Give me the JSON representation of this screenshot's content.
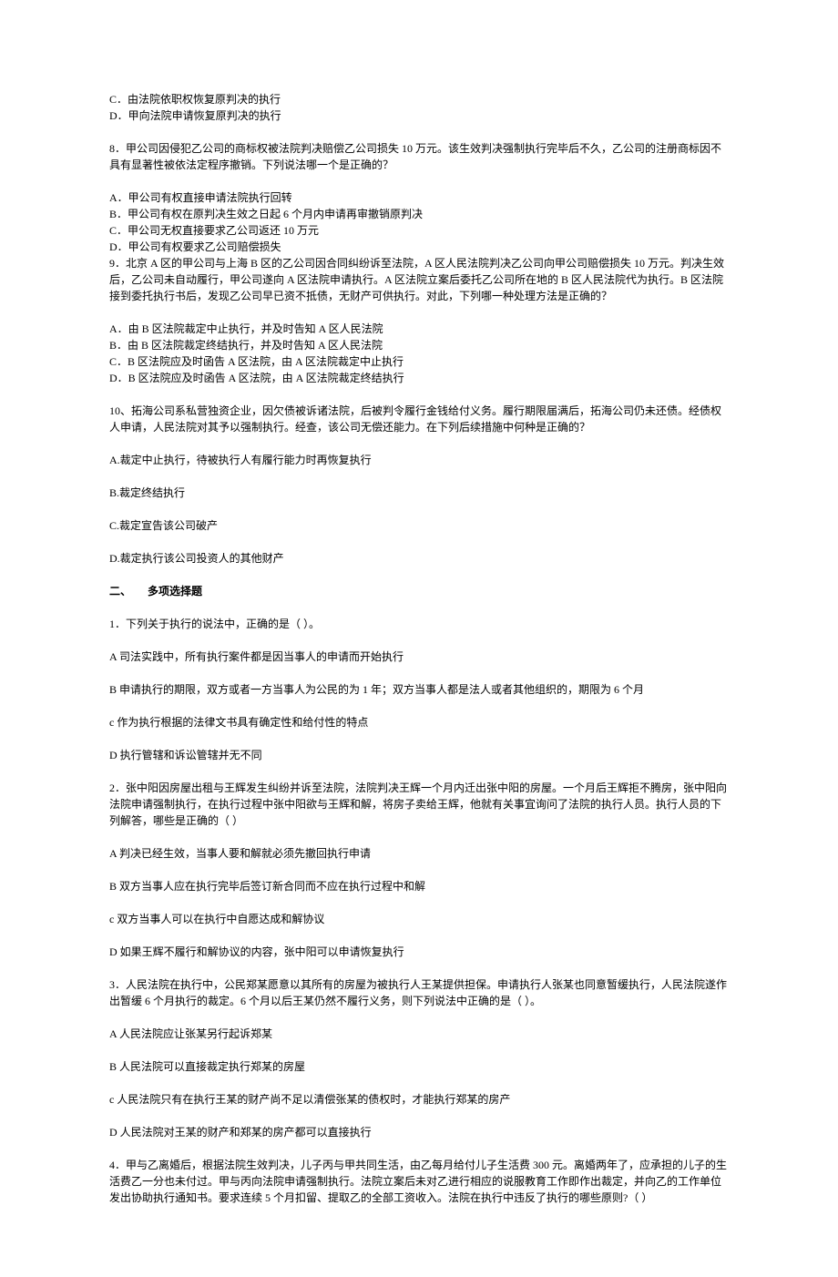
{
  "q7": {
    "optC": "C．由法院依职权恢复原判决的执行",
    "optD": "D．甲向法院申请恢复原判决的执行"
  },
  "q8": {
    "stem": "8．甲公司因侵犯乙公司的商标权被法院判决赔偿乙公司损失 10 万元。该生效判决强制执行完毕后不久，乙公司的注册商标因不具有显著性被依法定程序撤销。下列说法哪一个是正确的？",
    "optA": "A．甲公司有权直接申请法院执行回转",
    "optB": "B．甲公司有权在原判决生效之日起 6 个月内申请再审撤销原判决",
    "optC": "C．甲公司无权直接要求乙公司返还 10 万元",
    "optD": "D．甲公司有权要求乙公司赔偿损失"
  },
  "q9": {
    "stem": "9．北京 A 区的甲公司与上海 B 区的乙公司因合同纠纷诉至法院，A 区人民法院判决乙公司向甲公司赔偿损失 10 万元。判决生效后，乙公司未自动履行，甲公司遂向 A 区法院申请执行。A 区法院立案后委托乙公司所在地的 B 区人民法院代为执行。B 区法院接到委托执行书后，发现乙公司早已资不抵债，无财产可供执行。对此，下列哪一种处理方法是正确的？",
    "optA": "A．由 B 区法院裁定中止执行，并及时告知 A 区人民法院",
    "optB": "B．由 B 区法院裁定终结执行，并及时告知 A 区人民法院",
    "optC": "C．B 区法院应及时函告 A 区法院，由 A 区法院裁定中止执行",
    "optD": "D．B 区法院应及时函告 A 区法院，由 A 区法院裁定终结执行"
  },
  "q10": {
    "stem": "10、拓海公司系私营独资企业，因欠债被诉诸法院，后被判令履行金钱给付义务。履行期限届满后，拓海公司仍未还债。经债权人申请，人民法院对其予以强制执行。经查，该公司无偿还能力。在下列后续措施中何种是正确的？",
    "optA": "A.裁定中止执行，待被执行人有履行能力时再恢复执行",
    "optB": "B.裁定终结执行",
    "optC": "C.裁定宣告该公司破产",
    "optD": "D.裁定执行该公司投资人的其他财产"
  },
  "section2": "二、　　多项选择题",
  "m1": {
    "stem": "1．下列关于执行的说法中，正确的是（ ）。",
    "optA": "A 司法实践中，所有执行案件都是因当事人的申请而开始执行",
    "optB": "B 申请执行的期限，双方或者一方当事人为公民的为 1 年；双方当事人都是法人或者其他组织的，期限为 6 个月",
    "optC": "c 作为执行根据的法律文书具有确定性和给付性的特点",
    "optD": "D 执行管辖和诉讼管辖并无不同"
  },
  "m2": {
    "stem": "2．张中阳因房屋出租与王辉发生纠纷并诉至法院，法院判决王辉一个月内迁出张中阳的房屋。一个月后王辉拒不腾房，张中阳向法院申请强制执行，在执行过程中张中阳欲与王辉和解，将房子卖给王辉，他就有关事宜询问了法院的执行人员。执行人员的下列解答，哪些是正确的（ ）",
    "optA": "A 判决已经生效，当事人要和解就必须先撤回执行申请",
    "optB": "B 双方当事人应在执行完毕后签订新合同而不应在执行过程中和解",
    "optC": "c 双方当事人可以在执行中自愿达成和解协议",
    "optD": "D 如果王辉不履行和解协议的内容，张中阳可以申请恢复执行"
  },
  "m3": {
    "stem": "3．人民法院在执行中，公民郑某愿意以其所有的房屋为被执行人王某提供担保。申请执行人张某也同意暂缓执行，人民法院遂作出暂缓 6 个月执行的裁定。6 个月以后王某仍然不履行义务，则下列说法中正确的是（ ）。",
    "optA": "A 人民法院应让张某另行起诉郑某",
    "optB": "B 人民法院可以直接裁定执行郑某的房屋",
    "optC": "c 人民法院只有在执行王某的财产尚不足以清偿张某的债权时，才能执行郑某的房产",
    "optD": "D 人民法院对王某的财产和郑某的房产都可以直接执行"
  },
  "m4": {
    "stem": "4．甲与乙离婚后，根据法院生效判决，儿子丙与甲共同生活，由乙每月给付儿子生活费 300 元。离婚两年了，应承担的儿子的生活费乙一分也未付过。甲与丙向法院申请强制执行。法院立案后未对乙进行相应的说服教育工作即作出裁定，并向乙的工作单位发出协助执行通知书。要求连续 5 个月扣留、提取乙的全部工资收入。法院在执行中违反了执行的哪些原则?（ ）"
  }
}
